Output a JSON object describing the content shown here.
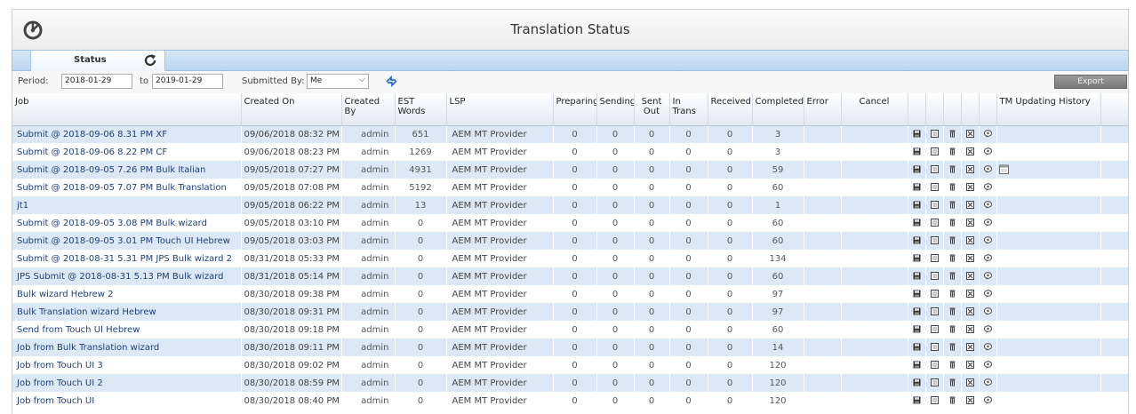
{
  "window": {
    "title": "Translation Status"
  },
  "tabs": {
    "status_label": "Status"
  },
  "filter": {
    "period_label": "Period:",
    "from_date": "2018-01-29",
    "to_label": "to",
    "to_date": "2019-01-29",
    "submitted_by_label": "Submitted By:",
    "submitted_by_value": "Me",
    "export_label": "Export"
  },
  "columns": {
    "job": "Job",
    "created_on": "Created On",
    "created_by": "Created By",
    "est_words": "EST Words",
    "lsp": "LSP",
    "preparing": "Preparing",
    "sending": "Sending",
    "sent_out": "Sent Out",
    "in_trans": "In Trans",
    "received": "Received",
    "completed": "Completed",
    "error": "Error",
    "cancel": "Cancel",
    "tm_updating_history": "TM Updating History"
  },
  "rows": [
    {
      "job": "Submit @ 2018-09-06 8.31 PM XF",
      "created_on": "09/06/2018 08:32 PM",
      "created_by": "admin",
      "est_words": "651",
      "lsp": "AEM MT Provider",
      "preparing": "0",
      "sending": "0",
      "sent_out": "0",
      "in_trans": "0",
      "received": "0",
      "completed": "3",
      "extra_icon": false
    },
    {
      "job": "Submit @ 2018-09-06 8.22 PM CF",
      "created_on": "09/06/2018 08:23 PM",
      "created_by": "admin",
      "est_words": "1269",
      "lsp": "AEM MT Provider",
      "preparing": "0",
      "sending": "0",
      "sent_out": "0",
      "in_trans": "0",
      "received": "0",
      "completed": "3",
      "extra_icon": false
    },
    {
      "job": "Submit @ 2018-09-05 7.26 PM Bulk Italian",
      "created_on": "09/05/2018 07:27 PM",
      "created_by": "admin",
      "est_words": "4931",
      "lsp": "AEM MT Provider",
      "preparing": "0",
      "sending": "0",
      "sent_out": "0",
      "in_trans": "0",
      "received": "0",
      "completed": "59",
      "extra_icon": true
    },
    {
      "job": "Submit @ 2018-09-05 7.07 PM Bulk Translation",
      "created_on": "09/05/2018 07:08 PM",
      "created_by": "admin",
      "est_words": "5192",
      "lsp": "AEM MT Provider",
      "preparing": "0",
      "sending": "0",
      "sent_out": "0",
      "in_trans": "0",
      "received": "0",
      "completed": "60",
      "extra_icon": false
    },
    {
      "job": "jt1",
      "created_on": "09/05/2018 06:22 PM",
      "created_by": "admin",
      "est_words": "13",
      "lsp": "AEM MT Provider",
      "preparing": "0",
      "sending": "0",
      "sent_out": "0",
      "in_trans": "0",
      "received": "0",
      "completed": "1",
      "extra_icon": false
    },
    {
      "job": "Submit @ 2018-09-05 3.08 PM Bulk wizard",
      "created_on": "09/05/2018 03:10 PM",
      "created_by": "admin",
      "est_words": "0",
      "lsp": "AEM MT Provider",
      "preparing": "0",
      "sending": "0",
      "sent_out": "0",
      "in_trans": "0",
      "received": "0",
      "completed": "60",
      "extra_icon": false
    },
    {
      "job": "Submit @ 2018-09-05 3.01 PM Touch UI Hebrew",
      "created_on": "09/05/2018 03:03 PM",
      "created_by": "admin",
      "est_words": "0",
      "lsp": "AEM MT Provider",
      "preparing": "0",
      "sending": "0",
      "sent_out": "0",
      "in_trans": "0",
      "received": "0",
      "completed": "60",
      "extra_icon": false
    },
    {
      "job": "Submit @ 2018-08-31 5.31 PM JPS Bulk wizard 2",
      "created_on": "08/31/2018 05:33 PM",
      "created_by": "admin",
      "est_words": "0",
      "lsp": "AEM MT Provider",
      "preparing": "0",
      "sending": "0",
      "sent_out": "0",
      "in_trans": "0",
      "received": "0",
      "completed": "134",
      "extra_icon": false
    },
    {
      "job": "JPS Submit @ 2018-08-31 5.13 PM Bulk wizard",
      "created_on": "08/31/2018 05:14 PM",
      "created_by": "admin",
      "est_words": "0",
      "lsp": "AEM MT Provider",
      "preparing": "0",
      "sending": "0",
      "sent_out": "0",
      "in_trans": "0",
      "received": "0",
      "completed": "60",
      "extra_icon": false
    },
    {
      "job": "Bulk wizard Hebrew 2",
      "created_on": "08/30/2018 09:38 PM",
      "created_by": "admin",
      "est_words": "0",
      "lsp": "AEM MT Provider",
      "preparing": "0",
      "sending": "0",
      "sent_out": "0",
      "in_trans": "0",
      "received": "0",
      "completed": "97",
      "extra_icon": false
    },
    {
      "job": "Bulk Translation wizard Hebrew",
      "created_on": "08/30/2018 09:31 PM",
      "created_by": "admin",
      "est_words": "0",
      "lsp": "AEM MT Provider",
      "preparing": "0",
      "sending": "0",
      "sent_out": "0",
      "in_trans": "0",
      "received": "0",
      "completed": "97",
      "extra_icon": false
    },
    {
      "job": "Send from Touch UI Hebrew",
      "created_on": "08/30/2018 09:18 PM",
      "created_by": "admin",
      "est_words": "0",
      "lsp": "AEM MT Provider",
      "preparing": "0",
      "sending": "0",
      "sent_out": "0",
      "in_trans": "0",
      "received": "0",
      "completed": "60",
      "extra_icon": false
    },
    {
      "job": "Job from Bulk Translation wizard",
      "created_on": "08/30/2018 09:11 PM",
      "created_by": "admin",
      "est_words": "0",
      "lsp": "AEM MT Provider",
      "preparing": "0",
      "sending": "0",
      "sent_out": "0",
      "in_trans": "0",
      "received": "0",
      "completed": "14",
      "extra_icon": false
    },
    {
      "job": "Job from Touch UI 3",
      "created_on": "08/30/2018 09:02 PM",
      "created_by": "admin",
      "est_words": "0",
      "lsp": "AEM MT Provider",
      "preparing": "0",
      "sending": "0",
      "sent_out": "0",
      "in_trans": "0",
      "received": "0",
      "completed": "120",
      "extra_icon": false
    },
    {
      "job": "Job from Touch UI 2",
      "created_on": "08/30/2018 08:59 PM",
      "created_by": "admin",
      "est_words": "0",
      "lsp": "AEM MT Provider",
      "preparing": "0",
      "sending": "0",
      "sent_out": "0",
      "in_trans": "0",
      "received": "0",
      "completed": "120",
      "extra_icon": false
    },
    {
      "job": "Job from Touch UI",
      "created_on": "08/30/2018 08:40 PM",
      "created_by": "admin",
      "est_words": "0",
      "lsp": "AEM MT Provider",
      "preparing": "0",
      "sending": "0",
      "sent_out": "0",
      "in_trans": "0",
      "received": "0",
      "completed": "120",
      "extra_icon": false
    }
  ],
  "row_action_icons": [
    "save-icon",
    "view-icon",
    "delete-icon",
    "close-box-icon",
    "comment-icon"
  ],
  "colors": {
    "accent": "#1d3f7a",
    "row_alt": "#dce8f5",
    "tab_strip": "#bcd6f0"
  }
}
